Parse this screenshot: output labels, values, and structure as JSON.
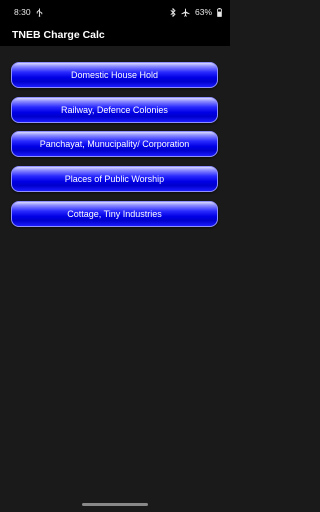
{
  "status_bar": {
    "time": "8:30",
    "battery": "63%",
    "icons": [
      "usb-debug-icon",
      "bluetooth-icon",
      "airplane-mode-icon",
      "battery-icon"
    ]
  },
  "app_bar": {
    "title": "TNEB Charge Calc"
  },
  "menu": {
    "items": [
      {
        "label": "Domestic House Hold"
      },
      {
        "label": "Railway, Defence Colonies"
      },
      {
        "label": "Panchayat, Munucipality/ Corporation"
      },
      {
        "label": "Places of Public Worship"
      },
      {
        "label": "Cottage, Tiny Industries"
      }
    ]
  },
  "colors": {
    "button_blue": "#0000e6",
    "background": "#1a1a1a",
    "bar": "#000000"
  }
}
